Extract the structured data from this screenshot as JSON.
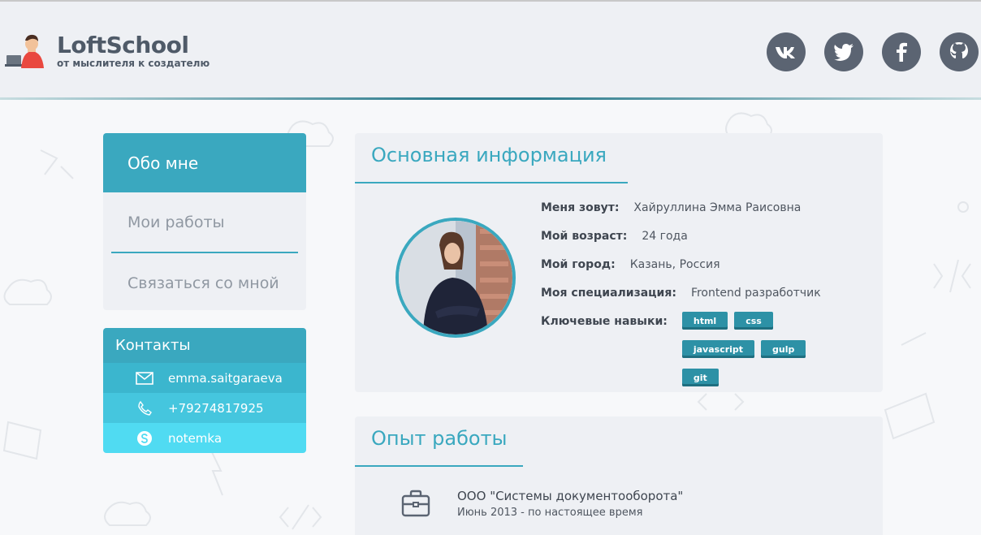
{
  "brand": {
    "name": "LoftSchool",
    "tagline": "от мыслителя к создателю"
  },
  "socials": [
    {
      "name": "vk",
      "glyph": "vk"
    },
    {
      "name": "twitter",
      "glyph": "t"
    },
    {
      "name": "facebook",
      "glyph": "f"
    },
    {
      "name": "github",
      "glyph": "gh"
    }
  ],
  "nav": {
    "items": [
      {
        "label": "Обо мне",
        "active": true
      },
      {
        "label": "Мои работы",
        "active": false
      },
      {
        "label": "Связаться со мной",
        "active": false
      }
    ]
  },
  "contacts": {
    "title": "Контакты",
    "email": "emma.saitgaraeva",
    "phone": "+79274817925",
    "skype": "notemka"
  },
  "main_info": {
    "title": "Основная информация",
    "name_label": "Меня зовут:",
    "name_value": "Хайруллина Эмма Раисовна",
    "age_label": "Мой возраст:",
    "age_value": "24 года",
    "city_label": "Мой город:",
    "city_value": "Казань, Россия",
    "spec_label": "Моя специализация:",
    "spec_value": "Frontend разработчик",
    "skills_label": "Ключевые навыки:",
    "skills": [
      "html",
      "css",
      "javascript",
      "gulp",
      "git"
    ]
  },
  "experience": {
    "title": "Опыт работы",
    "company": "ООО \"Системы документооборота\"",
    "period": "Июнь 2013 - по настоящее время"
  },
  "colors": {
    "accent": "#3aa8bf",
    "social_bg": "#5b6472",
    "panel_bg": "#eef0f4"
  }
}
